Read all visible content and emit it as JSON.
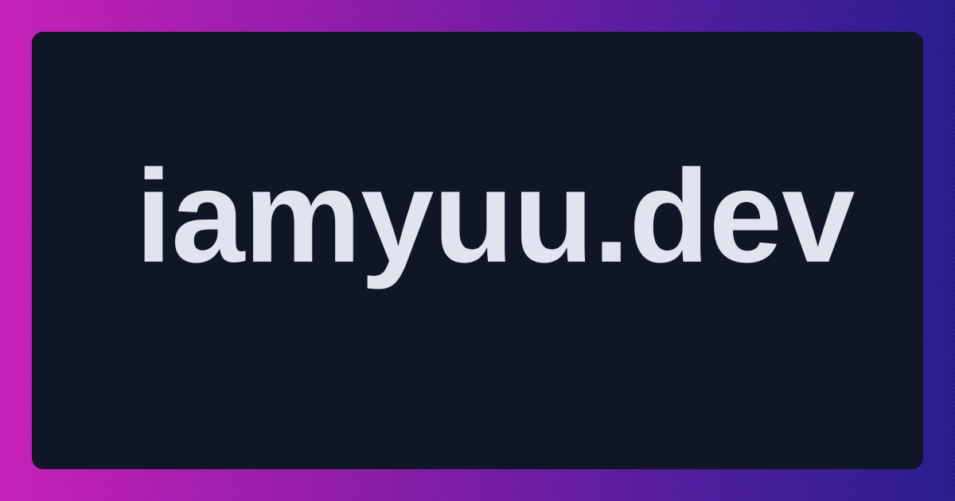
{
  "site": {
    "name": "iamyuu.dev"
  },
  "colors": {
    "gradient_start": "#c71fb8",
    "gradient_end": "#261a8c",
    "card_background": "#111626",
    "text": "#e0e4ef"
  }
}
